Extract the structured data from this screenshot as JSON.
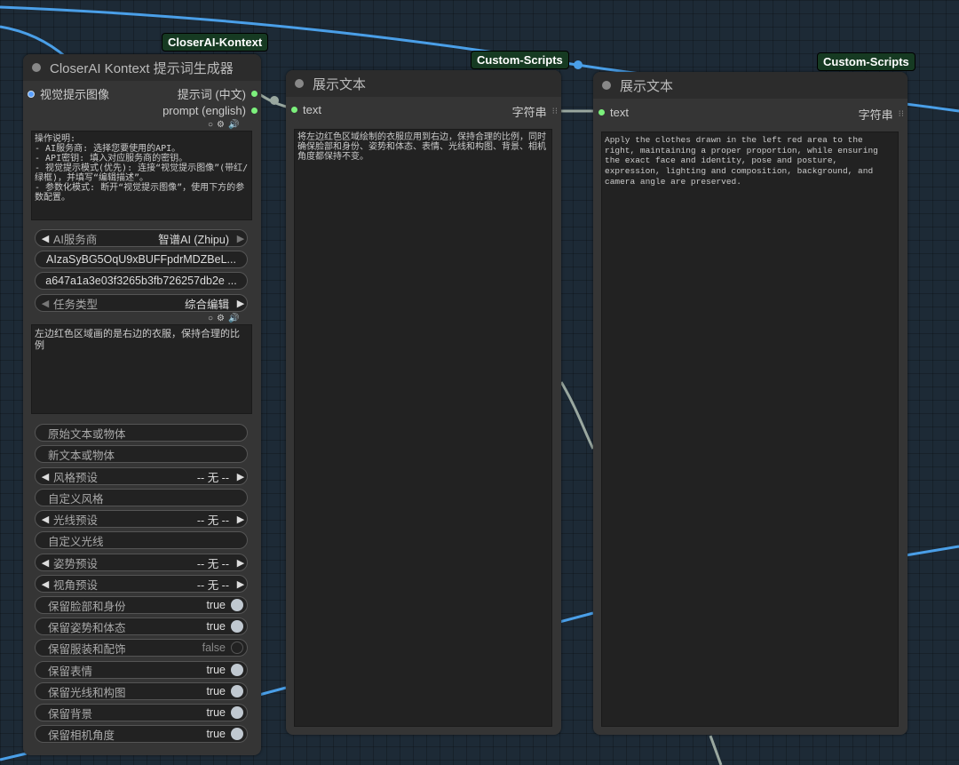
{
  "badges": {
    "kontext": "CloserAI-Kontext",
    "scripts1": "Custom-Scripts",
    "scripts2": "Custom-Scripts"
  },
  "node_kontext": {
    "title": "CloserAI Kontext 提示词生成器",
    "input_label": "视觉提示图像",
    "output_cn": "提示词 (中文)",
    "output_en": "prompt (english)",
    "instructions": "操作说明:\n- AI服务商: 选择您要使用的API。\n- API密钥: 填入对应服务商的密钥。\n- 视觉提示模式(优先): 连接“视觉提示图像”(带红/绿框)，并填写“编辑描述”。\n- 参数化模式: 断开“视觉提示图像”，使用下方的参数配置。",
    "ai_provider_label": "AI服务商",
    "ai_provider_value": "智谱AI (Zhipu)",
    "api_key_1": "AIzaSyBG5OqU9xBUFFpdrMDZBeL...",
    "api_key_2": "a647a1a3e03f3265b3fb726257db2e ...",
    "task_type_label": "任务类型",
    "task_type_value": "综合编辑",
    "edit_desc": "左边红色区域画的是右边的衣服，保持合理的比例",
    "original_text_placeholder": "原始文本或物体",
    "new_text_placeholder": "新文本或物体",
    "style_preset_label": "风格预设",
    "style_preset_value": "-- 无 --",
    "custom_style_placeholder": "自定义风格",
    "light_preset_label": "光线预设",
    "light_preset_value": "-- 无 --",
    "custom_light_placeholder": "自定义光线",
    "pose_preset_label": "姿势预设",
    "pose_preset_value": "-- 无 --",
    "view_preset_label": "视角预设",
    "view_preset_value": "-- 无 --",
    "toggles": [
      {
        "label": "保留脸部和身份",
        "value": "true"
      },
      {
        "label": "保留姿势和体态",
        "value": "true"
      },
      {
        "label": "保留服装和配饰",
        "value": "false"
      },
      {
        "label": "保留表情",
        "value": "true"
      },
      {
        "label": "保留光线和构图",
        "value": "true"
      },
      {
        "label": "保留背景",
        "value": "true"
      },
      {
        "label": "保留相机角度",
        "value": "true"
      }
    ]
  },
  "node_show1": {
    "title": "展示文本",
    "input_label": "text",
    "output_label": "字符串",
    "content": "将左边红色区域绘制的衣服应用到右边，保持合理的比例，同时确保脸部和身份、姿势和体态、表情、光线和构图、背景、相机角度都保持不变。"
  },
  "node_show2": {
    "title": "展示文本",
    "input_label": "text",
    "output_label": "字符串",
    "content": "Apply the clothes drawn in the left red area to the right, maintaining a proper proportion, while ensuring the exact face and identity, pose and posture, expression, lighting and composition, background, and camera angle are preserved."
  },
  "colors": {
    "link_blue": "#4a9fe8",
    "link_grey": "#9aa8a0",
    "badge_bg": "#163a22",
    "slot_green": "#7cf07c"
  }
}
